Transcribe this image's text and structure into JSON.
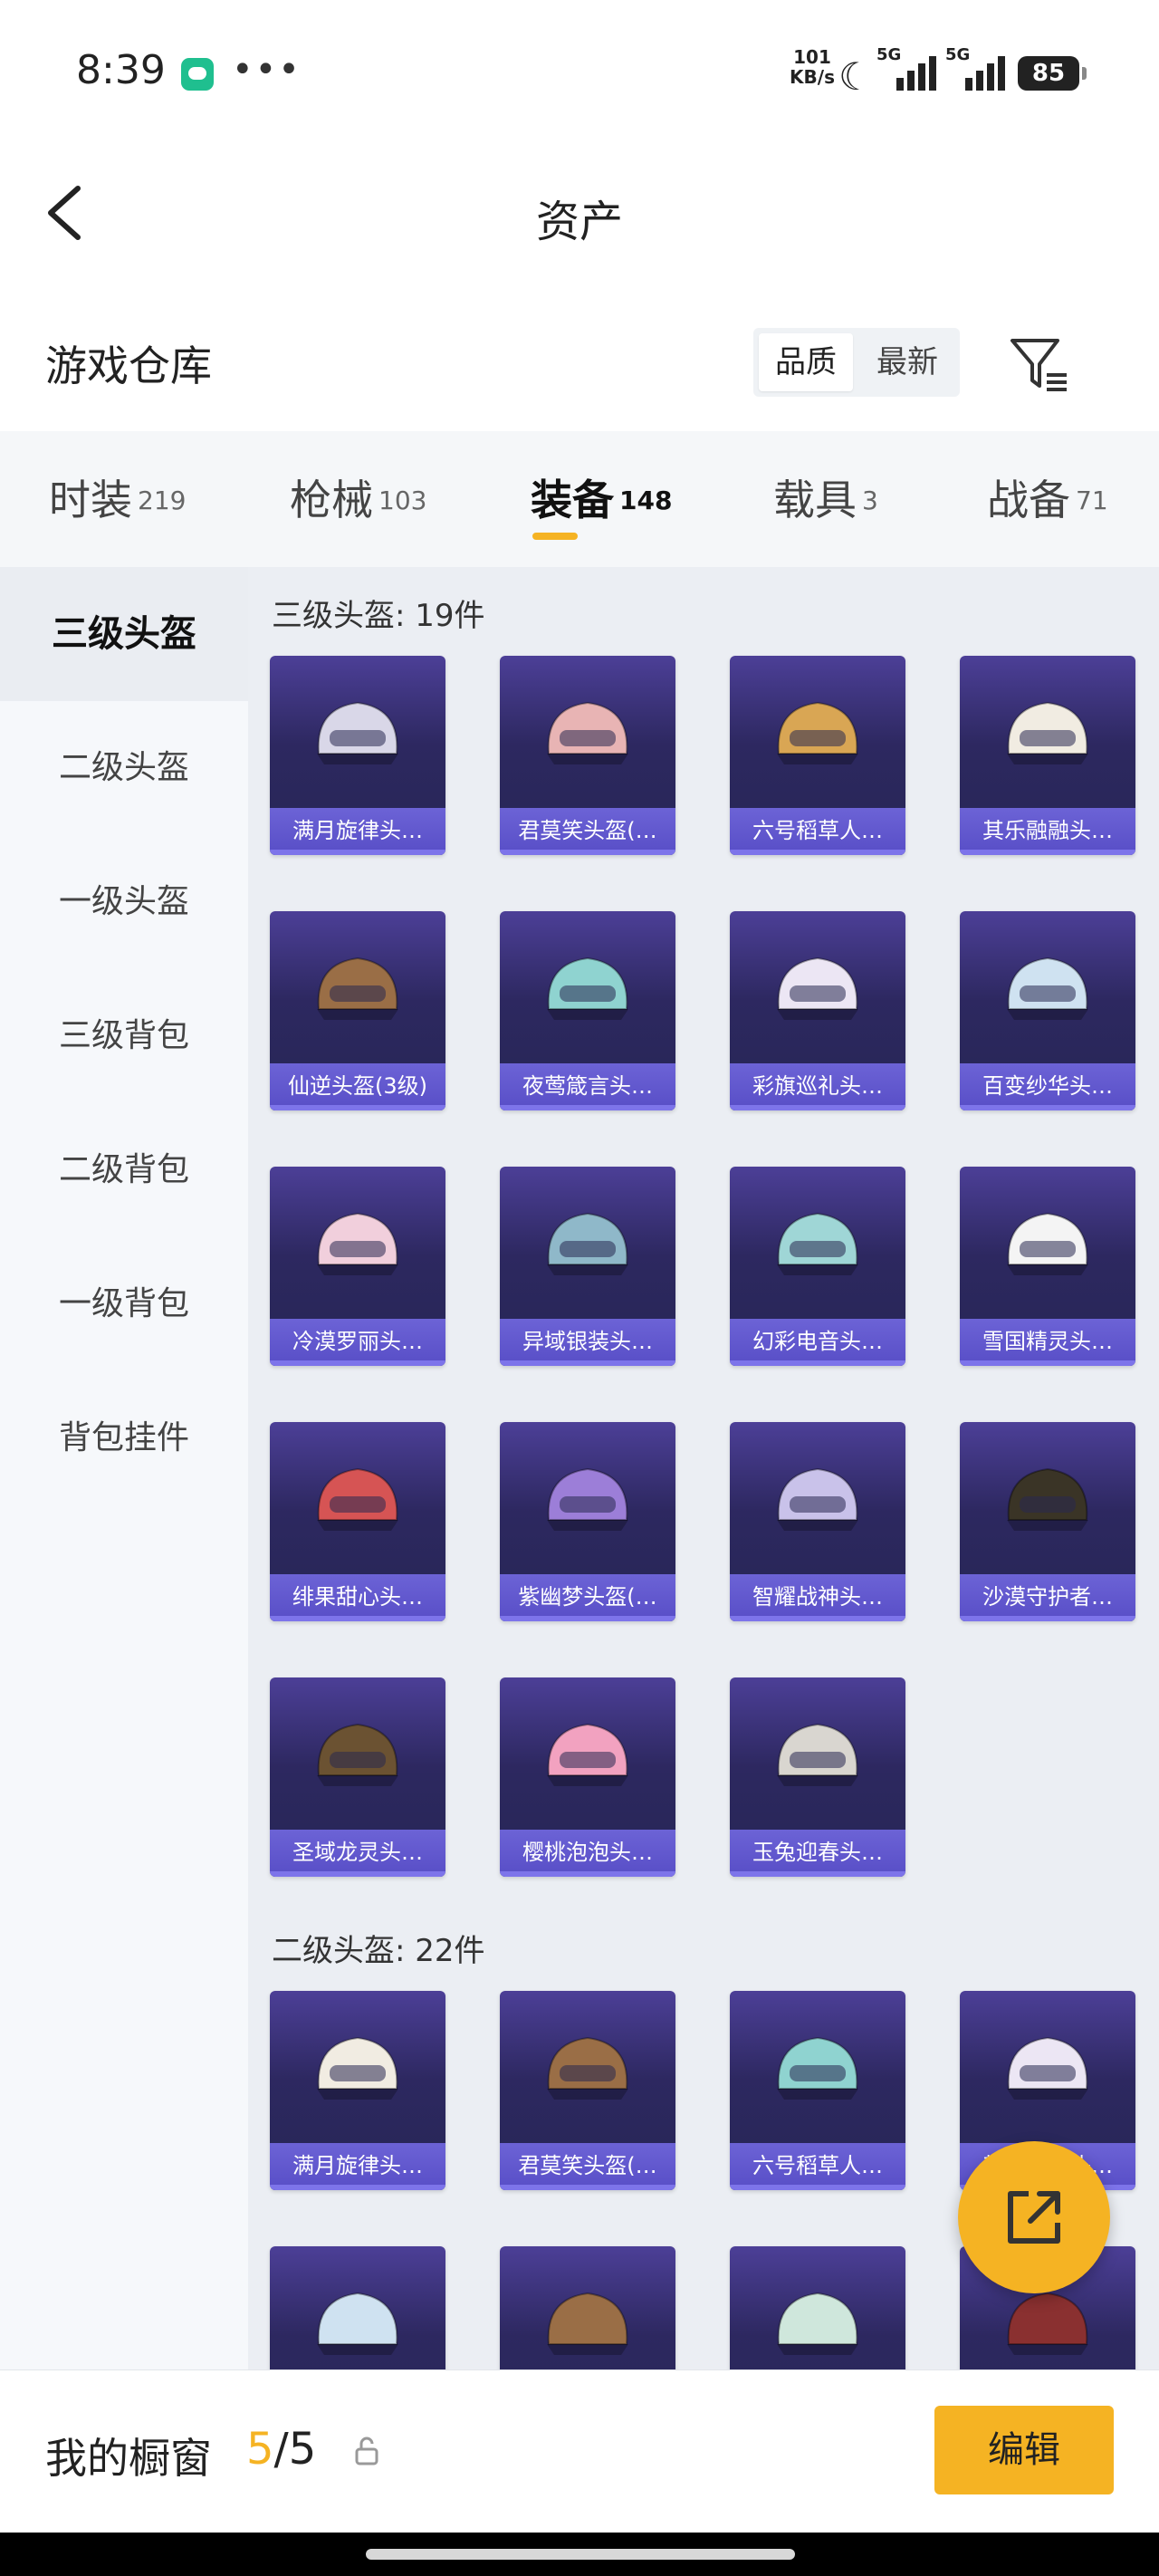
{
  "status_bar": {
    "time": "8:39",
    "net_speed_value": "101",
    "net_speed_unit": "KB/s",
    "sim1": "5G",
    "sim2": "5G",
    "battery": "85",
    "icons": [
      "wechat-icon",
      "more-dots-icon",
      "moon-icon",
      "signal-icon",
      "battery-icon"
    ]
  },
  "header": {
    "title": "资产",
    "back_icon": "chevron-left-icon"
  },
  "section": {
    "title": "游戏仓库",
    "sort_options": [
      "品质",
      "最新"
    ],
    "sort_selected": "品质",
    "filter_icon": "filter-icon"
  },
  "tabs": [
    {
      "label": "时装",
      "count": "219"
    },
    {
      "label": "枪械",
      "count": "103"
    },
    {
      "label": "装备",
      "count": "148",
      "active": true
    },
    {
      "label": "载具",
      "count": "3"
    },
    {
      "label": "战备",
      "count": "71"
    }
  ],
  "sidebar": {
    "items": [
      "三级头盔",
      "二级头盔",
      "一级头盔",
      "三级背包",
      "二级背包",
      "一级背包",
      "背包挂件"
    ],
    "active": "三级头盔"
  },
  "groups": [
    {
      "title": "三级头盔: 19件",
      "items": [
        "满月旋律头…",
        "君莫笑头盔(…",
        "六号稻草人…",
        "其乐融融头…",
        "仙逆头盔(3级)",
        "夜莺箴言头…",
        "彩旗巡礼头…",
        "百变纱华头…",
        "冷漠罗丽头…",
        "异域银装头…",
        "幻彩电音头…",
        "雪国精灵头…",
        "绯果甜心头…",
        "紫幽梦头盔(…",
        "智耀战神头…",
        "沙漠守护者…",
        "圣域龙灵头…",
        "樱桃泡泡头…",
        "玉兔迎春头…"
      ]
    },
    {
      "title": "二级头盔: 22件",
      "items": [
        "满月旋律头…",
        "君莫笑头盔(…",
        "六号稻草人…",
        "其乐融融头…"
      ]
    }
  ],
  "bottom_bar": {
    "label": "我的橱窗",
    "count_current": "5",
    "count_total": "/5",
    "edit_label": "编辑"
  },
  "colors": {
    "accent": "#f5b323",
    "card_dark": "#262655",
    "card_label": "#5a50c8"
  }
}
